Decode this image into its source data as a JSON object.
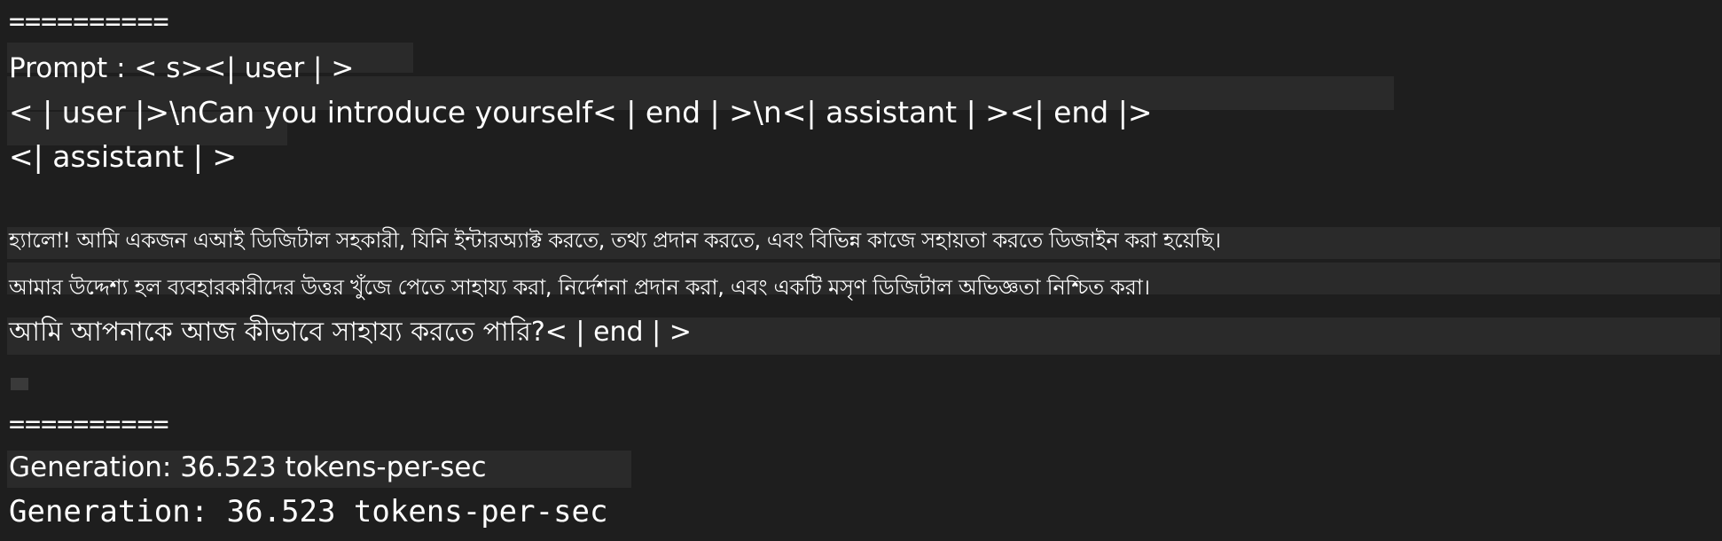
{
  "terminal": {
    "separator_top": "==========",
    "prompt_line": "Prompt : < s><| user | >",
    "prompt_body_line": "< | user |>\\nCan you introduce yourself< | end | >\\n<| assistant | ><| end |>",
    "assistant_tag_line": "<| assistant | >",
    "response_line_1": "হ্যালো! আমি একজন এআই ডিজিটাল সহকারী, যিনি ইন্টারঅ্যাক্ট করতে, তথ্য প্রদান করতে, এবং বিভিন্ন কাজে সহায়তা করতে ডিজাইন করা হয়েছি।",
    "response_line_2": "আমার উদ্দেশ্য হল ব্যবহারকারীদের উত্তর খুঁজে পেতে সাহায্য করা, নির্দেশনা প্রদান করা, এবং একটি মসৃণ ডিজিটাল অভিজ্ঞতা নিশ্চিত করা।",
    "response_line_3": "আমি আপনাকে আজ কীভাবে সাহায্য করতে পারি?< | end | >",
    "separator_bottom": "==========",
    "generation_line": "Generation: 36.523 tokens-per-sec",
    "generation_line_mono": "Generation: 36.523 tokens-per-sec"
  },
  "colors": {
    "background": "#1e1e1e",
    "text": "#ffffff",
    "line_highlight": "#2a2a2a"
  }
}
